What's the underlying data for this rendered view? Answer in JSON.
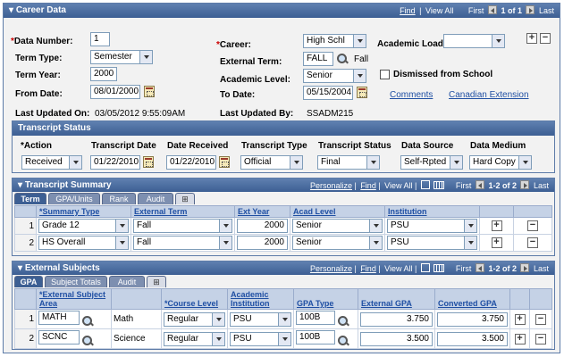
{
  "career": {
    "title": "Career Data",
    "nav": {
      "find": "Find",
      "sep": "|",
      "view_all": "View All",
      "first": "First",
      "count": "1 of 1",
      "last": "Last"
    },
    "fields": {
      "data_number_label": "Data Number:",
      "data_number_req": "*",
      "data_number_value": "1",
      "term_type_label": "Term Type:",
      "term_type_value": "Semester",
      "term_year_label": "Term Year:",
      "term_year_value": "2000",
      "from_date_label": "From Date:",
      "from_date_value": "08/01/2000",
      "career_label": "Career:",
      "career_req": "*",
      "career_value": "High Schl",
      "external_term_label": "External Term:",
      "external_term_value": "FALL",
      "external_term_desc": "Fall",
      "academic_level_label": "Academic Level:",
      "academic_level_value": "Senior",
      "to_date_label": "To Date:",
      "to_date_value": "05/15/2004",
      "academic_load_label": "Academic Load:",
      "academic_load_value": "",
      "dismissed_label": "Dismissed from School",
      "comments_link": "Comments",
      "canadian_link": "Canadian Extension",
      "last_updated_on_label": "Last Updated On:",
      "last_updated_on_value": "03/05/2012  9:55:09AM",
      "last_updated_by_label": "Last Updated By:",
      "last_updated_by_value": "SSADM215"
    }
  },
  "transcript_status": {
    "title": "Transcript Status",
    "headers": [
      "*Action",
      "Transcript Date",
      "Date Received",
      "Transcript Type",
      "Transcript Status",
      "Data Source",
      "Data Medium"
    ],
    "values": {
      "action": "Received",
      "transcript_date": "01/22/2010",
      "date_received": "01/22/2010",
      "transcript_type": "Official",
      "transcript_status": "Final",
      "data_source": "Self-Rpted",
      "data_medium": "Hard Copy"
    }
  },
  "transcript_summary": {
    "title": "Transcript Summary",
    "nav": {
      "personalize": "Personalize",
      "find": "Find",
      "view_all": "View All",
      "first": "First",
      "count": "1-2 of 2",
      "last": "Last"
    },
    "tabs": [
      "Term",
      "GPA/Units",
      "Rank",
      "Audit"
    ],
    "columns": [
      "*Summary Type",
      "External Term",
      "Ext Year",
      "Acad Level",
      "Institution"
    ],
    "rows": [
      {
        "num": "1",
        "summary_type": "Grade 12",
        "external_term": "Fall",
        "ext_year": "2000",
        "acad_level": "Senior",
        "institution": "PSU"
      },
      {
        "num": "2",
        "summary_type": "HS Overall",
        "external_term": "Fall",
        "ext_year": "2000",
        "acad_level": "Senior",
        "institution": "PSU"
      }
    ]
  },
  "external_subjects": {
    "title": "External Subjects",
    "nav": {
      "personalize": "Personalize",
      "find": "Find",
      "view_all": "View All",
      "first": "First",
      "count": "1-2 of 2",
      "last": "Last"
    },
    "tabs": [
      "GPA",
      "Subject Totals",
      "Audit"
    ],
    "columns": [
      "*External Subject Area",
      "*Course Level",
      "Academic Institution",
      "GPA Type",
      "External GPA",
      "Converted GPA"
    ],
    "rows": [
      {
        "num": "1",
        "subject_area": "MATH",
        "subject_desc": "Math",
        "course_level": "Regular",
        "institution": "PSU",
        "gpa_type": "100B",
        "external_gpa": "3.750",
        "converted_gpa": "3.750"
      },
      {
        "num": "2",
        "subject_area": "SCNC",
        "subject_desc": "Science",
        "course_level": "Regular",
        "institution": "PSU",
        "gpa_type": "100B",
        "external_gpa": "3.500",
        "converted_gpa": "3.500"
      }
    ]
  },
  "icons": {
    "plus": "+",
    "minus": "−"
  }
}
